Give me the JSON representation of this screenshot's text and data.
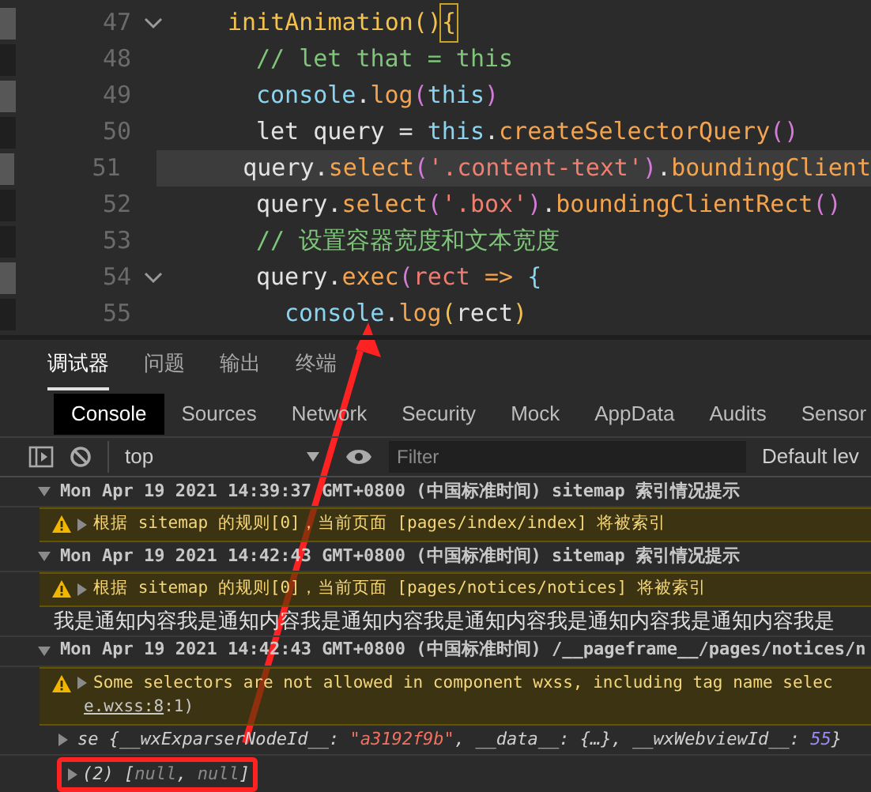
{
  "editor": {
    "lines": [
      {
        "number": "47",
        "foldable": true,
        "modified": true,
        "current": false,
        "tokens": [
          {
            "kind": "fn",
            "text": "initAnimation"
          },
          {
            "kind": "fn",
            "text": "()"
          },
          {
            "kind": "brace",
            "text": "{"
          }
        ],
        "children": [
          {
            "number": "48",
            "foldable": false,
            "modified": false,
            "current": false,
            "tokens": [
              {
                "kind": "comment",
                "text": "// let that = this"
              }
            ]
          },
          {
            "number": "49",
            "foldable": false,
            "modified": true,
            "current": false,
            "tokens": [
              {
                "kind": "obj",
                "text": "console"
              },
              {
                "kind": "plain",
                "text": "."
              },
              {
                "kind": "method",
                "text": "log"
              },
              {
                "kind": "paren",
                "text": "("
              },
              {
                "kind": "obj",
                "text": "this"
              },
              {
                "kind": "paren",
                "text": ")"
              }
            ]
          },
          {
            "number": "50",
            "foldable": false,
            "modified": false,
            "current": false,
            "tokens": [
              {
                "kind": "plain",
                "text": "let query = "
              },
              {
                "kind": "obj",
                "text": "this"
              },
              {
                "kind": "plain",
                "text": "."
              },
              {
                "kind": "method",
                "text": "createSelectorQuery"
              },
              {
                "kind": "paren",
                "text": "()"
              }
            ]
          },
          {
            "number": "51",
            "foldable": false,
            "modified": true,
            "current": true,
            "tokens": [
              {
                "kind": "plain",
                "text": "query."
              },
              {
                "kind": "method",
                "text": "select"
              },
              {
                "kind": "paren",
                "text": "("
              },
              {
                "kind": "string",
                "text": "'.content-text'"
              },
              {
                "kind": "paren",
                "text": ")"
              },
              {
                "kind": "plain",
                "text": "."
              },
              {
                "kind": "method",
                "text": "boundingClient"
              }
            ]
          },
          {
            "number": "52",
            "foldable": false,
            "modified": false,
            "current": false,
            "tokens": [
              {
                "kind": "plain",
                "text": "query."
              },
              {
                "kind": "method",
                "text": "select"
              },
              {
                "kind": "paren",
                "text": "("
              },
              {
                "kind": "string",
                "text": "'.box'"
              },
              {
                "kind": "paren",
                "text": ")"
              },
              {
                "kind": "plain",
                "text": "."
              },
              {
                "kind": "method",
                "text": "boundingClientRect"
              },
              {
                "kind": "paren",
                "text": "()"
              }
            ]
          },
          {
            "number": "53",
            "foldable": false,
            "modified": false,
            "current": false,
            "tokens": [
              {
                "kind": "comment",
                "text": "// 设置容器宽度和文本宽度"
              }
            ]
          },
          {
            "number": "54",
            "foldable": true,
            "modified": true,
            "current": false,
            "tokens": [
              {
                "kind": "plain",
                "text": "query."
              },
              {
                "kind": "method",
                "text": "exec"
              },
              {
                "kind": "paren",
                "text": "("
              },
              {
                "kind": "param",
                "text": "rect"
              },
              {
                "kind": "method",
                "text": " => "
              },
              {
                "kind": "obj",
                "text": "{"
              }
            ],
            "children": [
              {
                "number": "55",
                "foldable": false,
                "modified": false,
                "current": false,
                "tokens": [
                  {
                    "kind": "obj",
                    "text": "console"
                  },
                  {
                    "kind": "plain",
                    "text": "."
                  },
                  {
                    "kind": "method",
                    "text": "log"
                  },
                  {
                    "kind": "brace",
                    "text": "("
                  },
                  {
                    "kind": "plain",
                    "text": "rect"
                  },
                  {
                    "kind": "brace",
                    "text": ")"
                  }
                ]
              }
            ]
          }
        ]
      }
    ]
  },
  "panel_tabs": [
    {
      "label": "调试器",
      "selected": true
    },
    {
      "label": "问题",
      "selected": false
    },
    {
      "label": "输出",
      "selected": false
    },
    {
      "label": "终端",
      "selected": false
    }
  ],
  "devtools_tabs": [
    {
      "label": "Console",
      "selected": true
    },
    {
      "label": "Sources",
      "selected": false
    },
    {
      "label": "Network",
      "selected": false
    },
    {
      "label": "Security",
      "selected": false
    },
    {
      "label": "Mock",
      "selected": false
    },
    {
      "label": "AppData",
      "selected": false
    },
    {
      "label": "Audits",
      "selected": false
    },
    {
      "label": "Sensor",
      "selected": false
    }
  ],
  "toolbar": {
    "context": "top",
    "filter_placeholder": "Filter",
    "levels": "Default lev"
  },
  "logs": [
    {
      "kind": "group",
      "text": "Mon Apr 19 2021 14:39:37 GMT+0800 (中国标准时间) sitemap 索引情况提示"
    },
    {
      "kind": "warning",
      "text": "根据 sitemap 的规则[0]，当前页面 [pages/index/index] 将被索引"
    },
    {
      "kind": "group",
      "text": "Mon Apr 19 2021 14:42:43 GMT+0800 (中国标准时间) sitemap 索引情况提示"
    },
    {
      "kind": "warning",
      "text": "根据 sitemap 的规则[0]，当前页面 [pages/notices/notices] 将被索引"
    },
    {
      "kind": "log",
      "text": "我是通知内容我是通知内容我是通知内容我是通知内容我是通知内容我是通知内容我是"
    },
    {
      "kind": "group",
      "text": "Mon Apr 19 2021 14:42:43 GMT+0800 (中国标准时间) /__pageframe__/pages/notices/n"
    },
    {
      "kind": "warning",
      "text": "Some selectors are not allowed in component wxss, including tag name selec",
      "link": "e.wxss:8",
      "after": ":1)"
    },
    {
      "kind": "object",
      "tokens": [
        {
          "kind": "plain",
          "text": "se {"
        },
        {
          "kind": "key",
          "text": "__wxExparserNodeId__"
        },
        {
          "kind": "plain",
          "text": ": "
        },
        {
          "kind": "string",
          "text": "\"a3192f9b\""
        },
        {
          "kind": "plain",
          "text": ", "
        },
        {
          "kind": "key",
          "text": "__data__"
        },
        {
          "kind": "plain",
          "text": ": {…}, "
        },
        {
          "kind": "key",
          "text": "__wxWebviewId__"
        },
        {
          "kind": "plain",
          "text": ": "
        },
        {
          "kind": "number",
          "text": "55"
        },
        {
          "kind": "plain",
          "text": "}"
        }
      ]
    },
    {
      "kind": "array",
      "tokens": [
        {
          "kind": "plain",
          "text": "(2) ["
        },
        {
          "kind": "null",
          "text": "null"
        },
        {
          "kind": "plain",
          "text": ", "
        },
        {
          "kind": "null",
          "text": "null"
        },
        {
          "kind": "plain",
          "text": "]"
        }
      ]
    }
  ]
}
